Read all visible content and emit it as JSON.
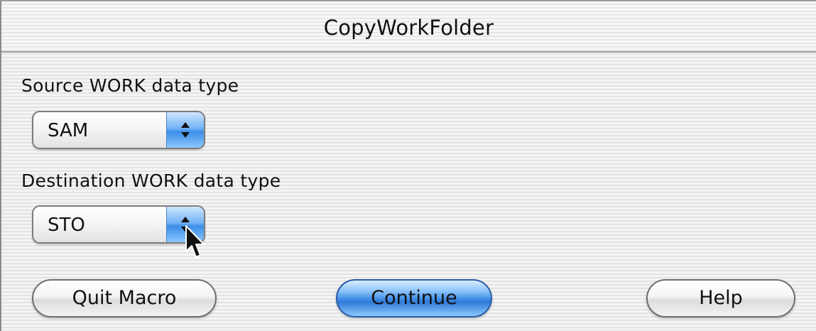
{
  "window": {
    "title": "CopyWorkFolder"
  },
  "source": {
    "label": "Source WORK data type",
    "value": "SAM",
    "arrow_icon": "updown-arrows-icon"
  },
  "destination": {
    "label": "Destination WORK data type",
    "value": "STO",
    "arrow_icon": "updown-arrows-icon"
  },
  "buttons": {
    "quit": "Quit Macro",
    "continue": "Continue",
    "help": "Help"
  },
  "cursor": {
    "icon": "mouse-pointer-icon"
  },
  "colors": {
    "accent": "#3f8ee6"
  }
}
